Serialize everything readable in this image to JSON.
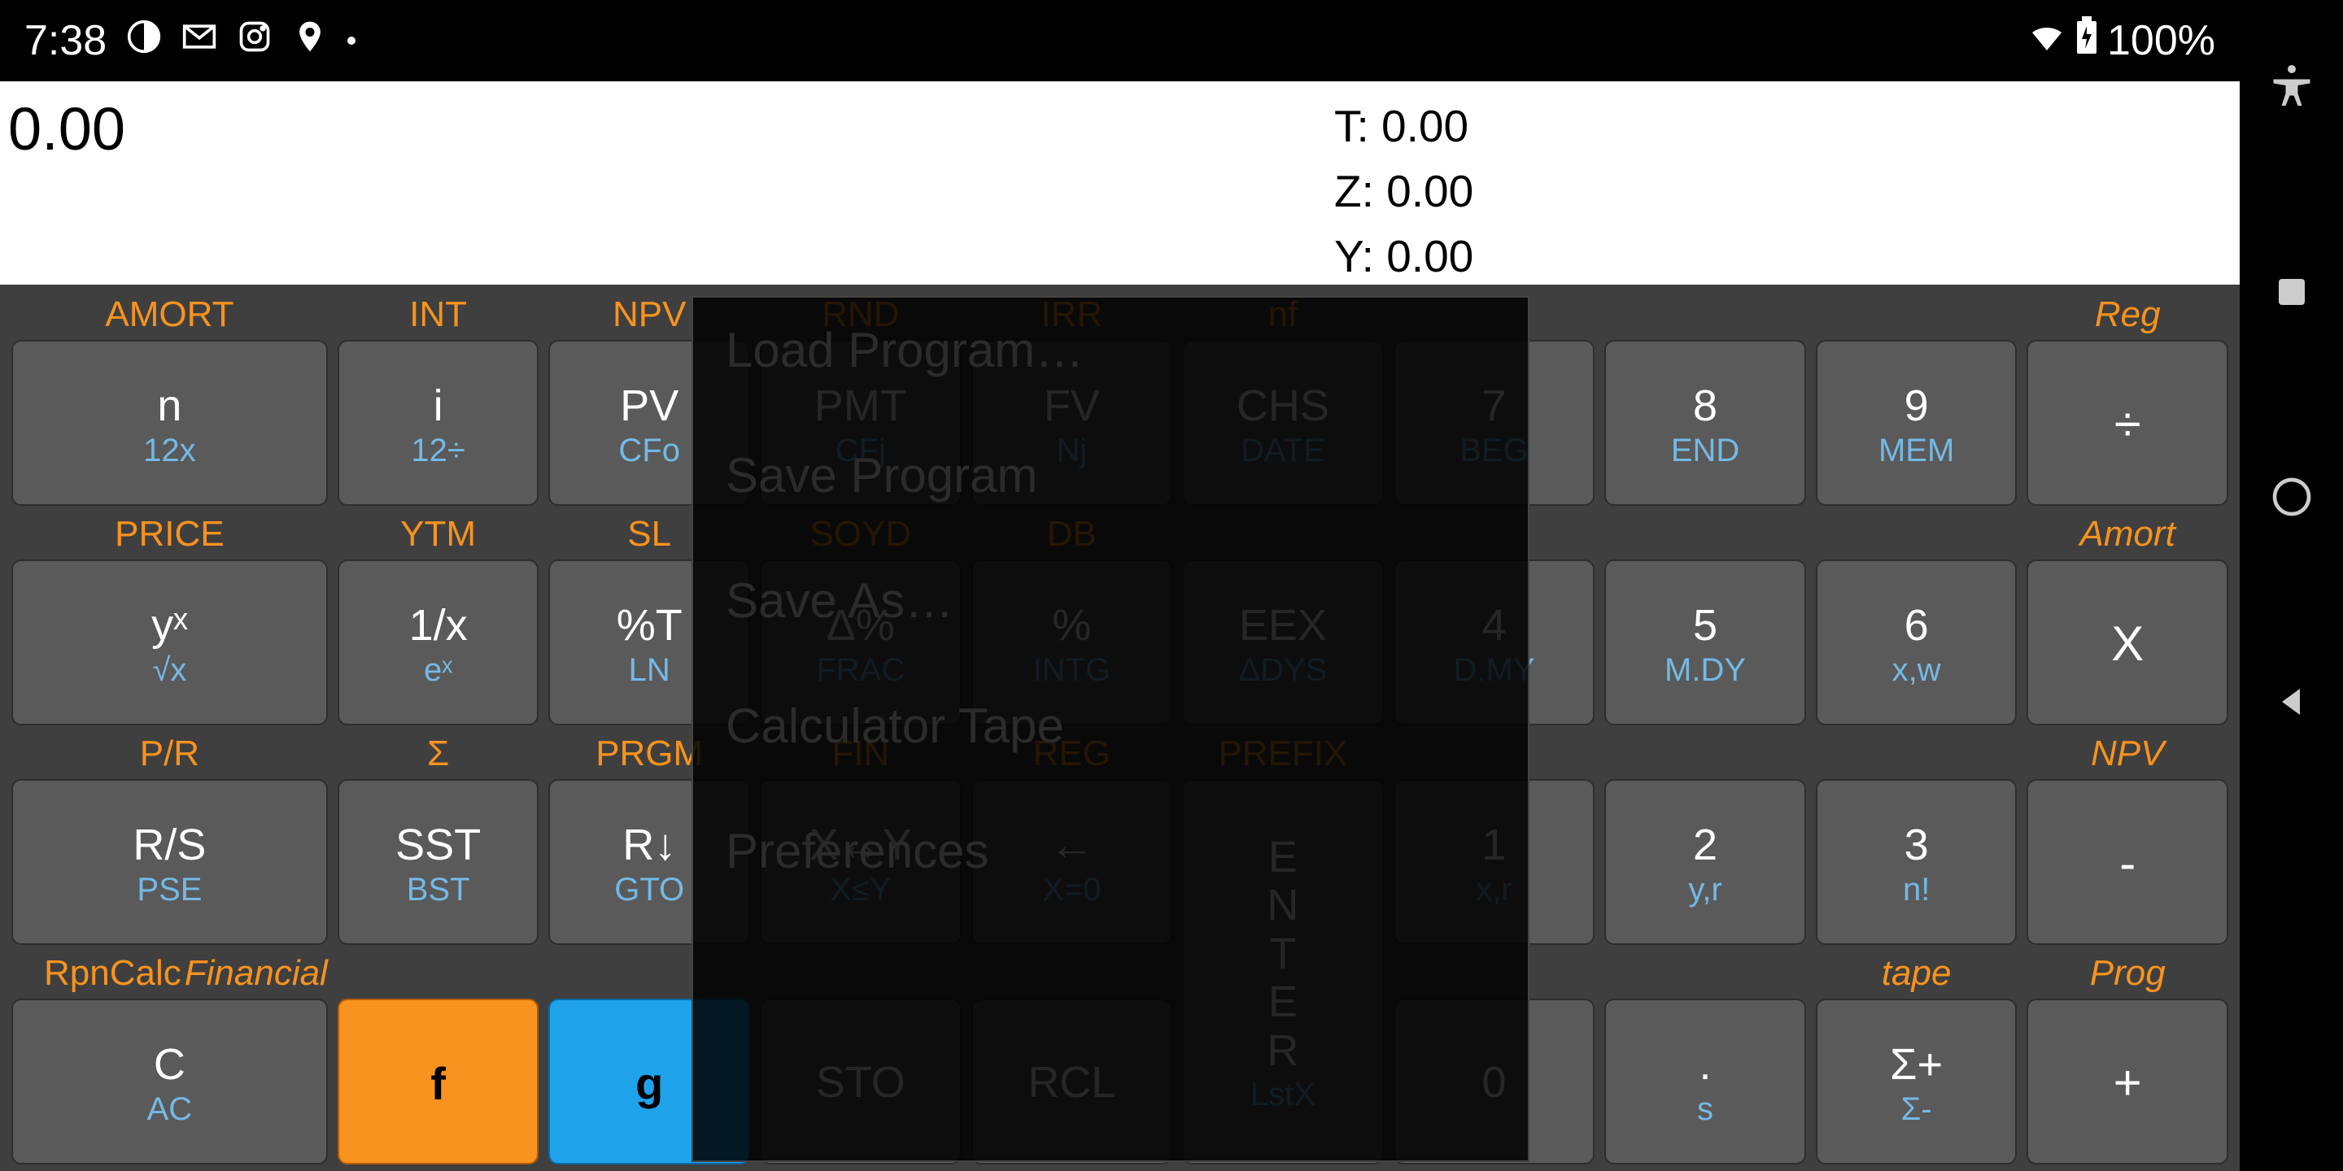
{
  "statusbar": {
    "time": "7:38",
    "battery": "100%"
  },
  "display": {
    "x": "0.00",
    "t": "T: 0.00",
    "z": "Z: 0.00",
    "y": "Y: 0.00"
  },
  "brand": {
    "name": "RpnCalc",
    "sub": "Financial"
  },
  "keys": {
    "r1": {
      "c1": {
        "f": "AMORT",
        "m": "n",
        "g": "12x"
      },
      "c2": {
        "f": "INT",
        "m": "i",
        "g": "12÷"
      },
      "c3": {
        "f": "NPV",
        "m": "PV",
        "g": "CFo"
      },
      "c4": {
        "f": "RND",
        "m": "PMT",
        "g": "CFj"
      },
      "c5": {
        "f": "IRR",
        "m": "FV",
        "g": "Nj"
      },
      "c6": {
        "f": "nf",
        "m": "CHS",
        "g": "DATE"
      },
      "c7": {
        "f": "",
        "m": "7",
        "g": "BEG"
      },
      "c8": {
        "f": "",
        "m": "8",
        "g": "END"
      },
      "c9": {
        "f": "",
        "m": "9",
        "g": "MEM"
      },
      "c10": {
        "f": "Reg",
        "m": "÷",
        "g": ""
      }
    },
    "r2": {
      "c1": {
        "f": "PRICE",
        "m": "yˣ",
        "g": "√x"
      },
      "c2": {
        "f": "YTM",
        "m": "1/x",
        "g": "eˣ"
      },
      "c3": {
        "f": "SL",
        "m": "%T",
        "g": "LN"
      },
      "c4": {
        "f": "SOYD",
        "m": "Δ%",
        "g": "FRAC"
      },
      "c5": {
        "f": "DB",
        "m": "%",
        "g": "INTG"
      },
      "c6": {
        "f": "",
        "m": "EEX",
        "g": "ΔDYS"
      },
      "c7": {
        "f": "",
        "m": "4",
        "g": "D.MY"
      },
      "c8": {
        "f": "",
        "m": "5",
        "g": "M.DY"
      },
      "c9": {
        "f": "",
        "m": "6",
        "g": "x,w"
      },
      "c10": {
        "f": "Amort",
        "m": "X",
        "g": ""
      }
    },
    "r3": {
      "c1": {
        "f": "P/R",
        "m": "R/S",
        "g": "PSE"
      },
      "c2": {
        "f": "Σ",
        "m": "SST",
        "g": "BST"
      },
      "c3": {
        "f": "PRGM",
        "m": "R↓",
        "g": "GTO"
      },
      "c4": {
        "f": "FIN",
        "m": "X↔Y",
        "g": "X≤Y"
      },
      "c5": {
        "f": "REG",
        "m": "←",
        "g": "X=0"
      },
      "c6enter": {
        "f": "PREFIX",
        "g": "LstX"
      },
      "c7": {
        "f": "",
        "m": "1",
        "g": "x,r"
      },
      "c8": {
        "f": "",
        "m": "2",
        "g": "y,r"
      },
      "c9": {
        "f": "",
        "m": "3",
        "g": "n!"
      },
      "c10": {
        "f": "NPV",
        "m": "-",
        "g": ""
      }
    },
    "r4": {
      "c1": {
        "f": "",
        "m": "C",
        "g": "AC"
      },
      "c2": {
        "f": "",
        "m": "f",
        "g": ""
      },
      "c3": {
        "f": "",
        "m": "g",
        "g": ""
      },
      "c4": {
        "f": "",
        "m": "STO",
        "g": ""
      },
      "c5": {
        "f": "",
        "m": "RCL",
        "g": ""
      },
      "c7": {
        "f": "",
        "m": "0",
        "g": ""
      },
      "c8": {
        "f": "",
        "m": ".",
        "g": "s"
      },
      "c9": {
        "f": "tape",
        "m": "Σ+",
        "g": "Σ-"
      },
      "c10": {
        "f": "Prog",
        "m": "+",
        "g": ""
      }
    }
  },
  "enter": {
    "letters": [
      "E",
      "N",
      "T",
      "E",
      "R"
    ]
  },
  "overlay": {
    "items": [
      "Load Program…",
      "Save Program",
      "Save As…",
      "Calculator Tape",
      "Preferences"
    ]
  }
}
